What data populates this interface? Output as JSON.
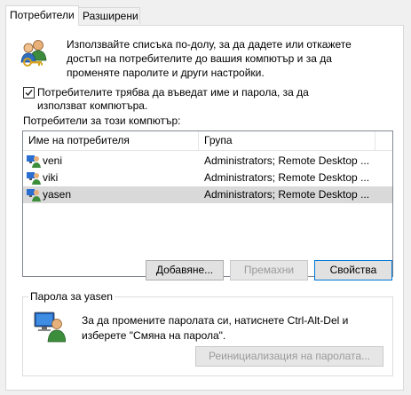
{
  "tabs": [
    {
      "label": "Потребители"
    },
    {
      "label": "Разширени"
    }
  ],
  "intro": {
    "text": "Използвайте списъка по-долу, за да дадете или откажете достъп на потребителите до вашия компютър и за да променяте паролите и други настройки."
  },
  "require_login": {
    "label": "Потребителите трябва да въведат име и парола, за да използват компютъра.",
    "checked": true
  },
  "users_section": {
    "label": "Потребители за този компютър:",
    "columns": [
      "Име на потребителя",
      "Група"
    ],
    "rows": [
      {
        "name": "veni",
        "group": "Administrators; Remote Desktop ..."
      },
      {
        "name": "viki",
        "group": "Administrators; Remote Desktop ..."
      },
      {
        "name": "yasen",
        "group": "Administrators; Remote Desktop ...",
        "selected": true
      }
    ]
  },
  "buttons": {
    "add": "Добавяне...",
    "remove": "Премахни",
    "properties": "Свойства"
  },
  "password_group": {
    "title": "Парола за yasen",
    "text": "За да промените паролата си, натиснете Ctrl-Alt-Del и изберете \"Смяна на парола\".",
    "reset_button": "Реинициализация на паролата..."
  }
}
